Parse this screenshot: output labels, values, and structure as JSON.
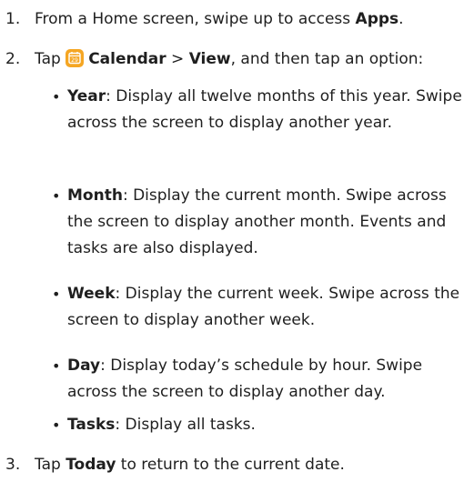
{
  "steps": [
    {
      "number": "1.",
      "text_before": "From a Home screen, swipe up to access ",
      "bold": "Apps",
      "text_after": "."
    },
    {
      "number": "2.",
      "text_before": "Tap ",
      "icon": "calendar-app-icon",
      "icon_number": "29",
      "bold_1": "Calendar",
      "separator": " > ",
      "bold_2": "View",
      "text_after": ", and then tap an option:"
    },
    {
      "number": "3.",
      "text_before": "Tap ",
      "bold": "Today",
      "text_after": " to return to the current date."
    }
  ],
  "options": [
    {
      "term": "Year",
      "description": ": Display all twelve months of this year. Swipe across the screen to display another year."
    },
    {
      "term": "Month",
      "description": ": Display the current month. Swipe across the screen to display another month. Events and tasks are also displayed."
    },
    {
      "term": "Week",
      "description": ": Display the current week. Swipe across the screen to display another week."
    },
    {
      "term": "Day",
      "description": ": Display today’s schedule by hour. Swipe across the screen to display another day."
    },
    {
      "term": "Tasks",
      "description": ": Display all tasks."
    }
  ],
  "bullet_char": "•",
  "colors": {
    "text": "#1f1f1f",
    "icon_bg": "#f5a623",
    "icon_fg": "#ffffff"
  }
}
